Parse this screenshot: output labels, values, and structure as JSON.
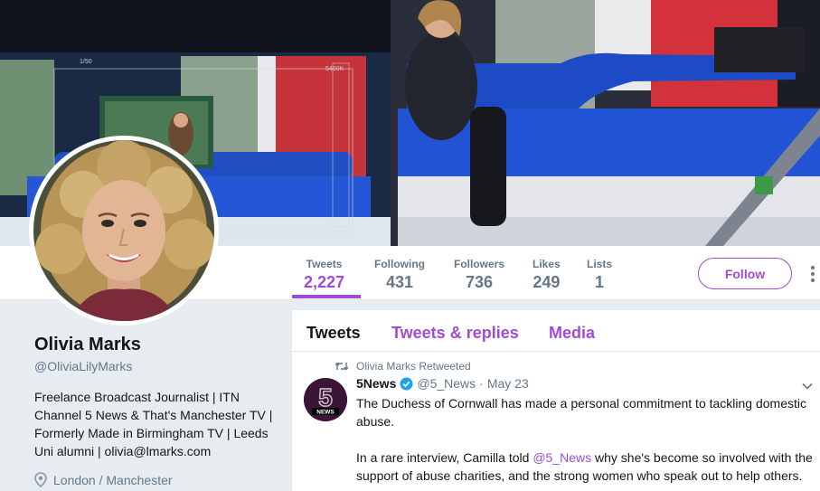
{
  "profile": {
    "name": "Olivia Marks",
    "handle": "@OliviaLilyMarks",
    "bio": "Freelance Broadcast Journalist | ITN Channel 5 News & That's Manchester TV | Formerly Made in Birmingham TV | Leeds Uni alumni | olivia@lmarks.com",
    "location": "London / Manchester"
  },
  "stats": [
    {
      "label": "Tweets",
      "value": "2,227"
    },
    {
      "label": "Following",
      "value": "431"
    },
    {
      "label": "Followers",
      "value": "736"
    },
    {
      "label": "Likes",
      "value": "249"
    },
    {
      "label": "Lists",
      "value": "1"
    }
  ],
  "follow_label": "Follow",
  "timeline_tabs": [
    "Tweets",
    "Tweets & replies",
    "Media"
  ],
  "tweet": {
    "context": "Olivia Marks Retweeted",
    "author_name": "5News",
    "author_handle": "@5_News",
    "separator": "·",
    "date": "May 23",
    "avatar_text": "NEWS",
    "text_1": "The Duchess of Cornwall has made a personal commitment to tackling domestic abuse.",
    "text_2_pre": "In a rare interview, Camilla told ",
    "text_2_mention": "@5_News",
    "text_2_post": " why she's become so involved with the support of abuse charities, and the strong women who speak out to help others."
  },
  "banner_overlay": {
    "counter": "1/50",
    "code": "5400K"
  },
  "colors": {
    "accent": "#9f4bd6",
    "secondary_text": "#657786",
    "background": "#e6ecf0"
  },
  "icons": {
    "retweet": "retweet-icon",
    "verified": "verified-badge-icon",
    "location": "location-pin-icon",
    "caret": "chevron-down-icon",
    "more": "more-dots-icon"
  }
}
